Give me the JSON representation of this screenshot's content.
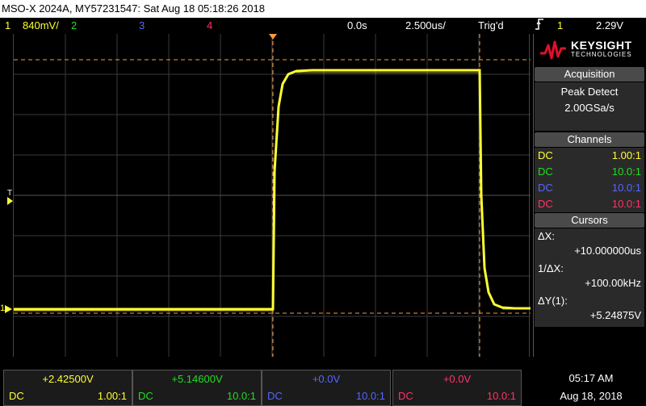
{
  "title": "MSO-X 2024A, MY57231547: Sat Aug 18 05:18:26 2018",
  "status": {
    "ch1_num": "1",
    "ch1_scale": "840mV/",
    "ch2_num": "2",
    "ch3_num": "3",
    "ch4_num": "4",
    "time_pos": "0.0s",
    "time_scale": "2.500us/",
    "trig_state": "Trig'd",
    "trig_icon": "rising-edge-icon",
    "trig_src": "1",
    "trig_level": "2.29V"
  },
  "colors": {
    "ch1": "#ffff33",
    "ch2": "#22dd22",
    "ch3": "#5566ff",
    "ch4": "#ff3366",
    "cursor": "#ff9933"
  },
  "screen": {
    "ground_marker": "1",
    "trigger_marker": "T"
  },
  "logo": {
    "brand": "KEYSIGHT",
    "sub": "TECHNOLOGIES"
  },
  "acquisition": {
    "heading": "Acquisition",
    "mode": "Peak Detect",
    "rate": "2.00GSa/s"
  },
  "channels": {
    "heading": "Channels",
    "rows": [
      {
        "coupling": "DC",
        "probe": "1.00:1"
      },
      {
        "coupling": "DC",
        "probe": "10.0:1"
      },
      {
        "coupling": "DC",
        "probe": "10.0:1"
      },
      {
        "coupling": "DC",
        "probe": "10.0:1"
      }
    ]
  },
  "cursors": {
    "heading": "Cursors",
    "dx_label": "ΔX:",
    "dx_value": "+10.000000us",
    "inv_label": "1/ΔX:",
    "inv_value": "+100.00kHz",
    "dy_label": "ΔY(1):",
    "dy_value": "+5.24875V"
  },
  "bottom": [
    {
      "offset": "+2.42500V",
      "coupling": "DC",
      "probe": "1.00:1"
    },
    {
      "offset": "+5.14600V",
      "coupling": "DC",
      "probe": "10.0:1"
    },
    {
      "offset": "+0.0V",
      "coupling": "DC",
      "probe": "10.0:1"
    },
    {
      "offset": "+0.0V",
      "coupling": "DC",
      "probe": "10.0:1"
    }
  ],
  "clock": {
    "time": "05:17 AM",
    "date": "Aug 18, 2018"
  }
}
